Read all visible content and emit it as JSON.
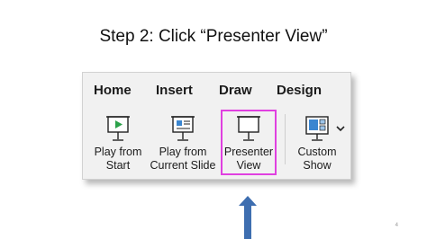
{
  "slide": {
    "title": "Step 2: Click “Presenter View”",
    "page_number": "4"
  },
  "ribbon": {
    "tabs": [
      "Home",
      "Insert",
      "Draw",
      "Design"
    ],
    "buttons": [
      {
        "line1": "Play from",
        "line2": "Start",
        "icon": "play-from-start-icon"
      },
      {
        "line1": "Play from",
        "line2": "Current Slide",
        "icon": "play-current-slide-icon"
      },
      {
        "line1": "Presenter",
        "line2": "View",
        "icon": "presenter-view-icon"
      },
      {
        "line1": "Custom",
        "line2": "Show",
        "icon": "custom-show-icon"
      }
    ]
  },
  "colors": {
    "highlight": "#e040e0",
    "arrow": "#3e6eb0",
    "play_accent": "#2ca24a",
    "slide_accent": "#3b86d0"
  }
}
